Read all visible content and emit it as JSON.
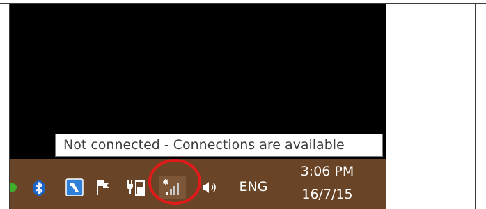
{
  "tooltip": {
    "text": "Not connected - Connections are available"
  },
  "tray": {
    "icons": [
      "overflow-green-icon",
      "bluetooth-icon",
      "tool-icon",
      "flag-icon",
      "power-icon",
      "network-signal-icon",
      "volume-icon"
    ],
    "language": "ENG",
    "time": "3:06 PM",
    "date": "16/7/15"
  },
  "colors": {
    "taskbar": "#6a4426",
    "desktop": "#000000",
    "highlight_ring": "#e11a1a",
    "bluetooth": "#1c66c9",
    "tool_icon": "#2f80d6"
  }
}
